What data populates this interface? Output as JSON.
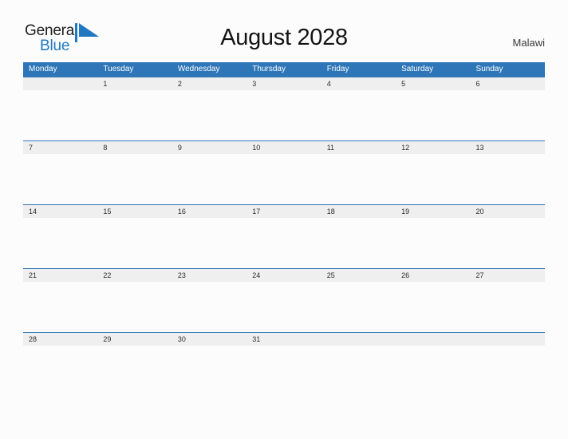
{
  "brand": {
    "name_part1": "General",
    "name_part2": "Blue",
    "mark": "pennant-triangle",
    "color_primary": "#1f78c1",
    "color_text": "#1c1c1c"
  },
  "header": {
    "title": "August 2028",
    "region": "Malawi"
  },
  "theme": {
    "header_blue": "#2e76b8",
    "band_gray": "#efefef",
    "page_background": "#fcfcfd",
    "date_text": "#2c2c2c",
    "weekday_text": "#ffffff"
  },
  "calendar": {
    "weekdays": [
      "Monday",
      "Tuesday",
      "Wednesday",
      "Thursday",
      "Friday",
      "Saturday",
      "Sunday"
    ],
    "weeks": [
      [
        "",
        "1",
        "2",
        "3",
        "4",
        "5",
        "6"
      ],
      [
        "7",
        "8",
        "9",
        "10",
        "11",
        "12",
        "13"
      ],
      [
        "14",
        "15",
        "16",
        "17",
        "18",
        "19",
        "20"
      ],
      [
        "21",
        "22",
        "23",
        "24",
        "25",
        "26",
        "27"
      ],
      [
        "28",
        "29",
        "30",
        "31",
        "",
        "",
        ""
      ]
    ]
  }
}
